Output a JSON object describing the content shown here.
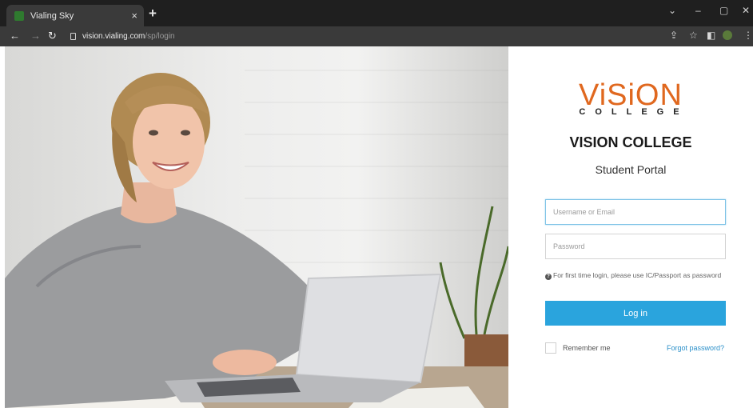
{
  "browser": {
    "tab_title": "Vialing Sky",
    "tab_close": "×",
    "new_tab": "+",
    "url_host": "vision.vialing.com",
    "url_path": "/sp/login",
    "window_controls": {
      "minimize": "–",
      "maximize": "▢",
      "close": "✕",
      "tab_search": "⌄"
    }
  },
  "login": {
    "logo_word": "ViSiON",
    "logo_sub": "COLLEGE",
    "title": "VISION COLLEGE",
    "subtitle": "Student Portal",
    "username_placeholder": "Username or Email",
    "password_placeholder": "Password",
    "hint": "For first time login, please use IC/Passport as password",
    "login_button": "Log in",
    "remember_label": "Remember me",
    "forgot_link": "Forgot password?"
  },
  "colors": {
    "brand_orange": "#e0681f",
    "login_button": "#2aa4dd",
    "link": "#2a8fc9"
  }
}
